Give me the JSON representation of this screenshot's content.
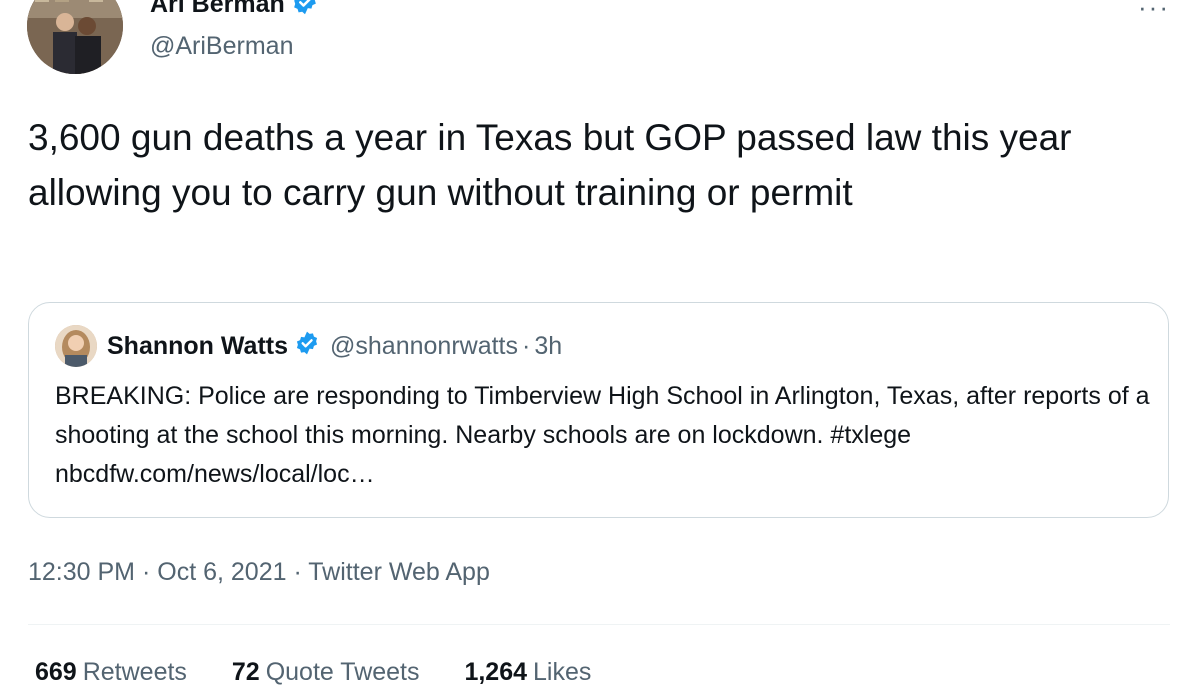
{
  "author": {
    "name": "Ari Berman",
    "handle": "@AriBerman"
  },
  "more_label": "···",
  "tweet": {
    "text": "3,600 gun deaths a year in Texas but GOP passed law this year allowing you to carry gun without training or permit"
  },
  "quote": {
    "name": "Shannon Watts",
    "handle": "@shannonrwatts",
    "separator": "·",
    "time": "3h",
    "text": "BREAKING: Police are responding to Timberview High School in Arlington, Texas, after reports of a shooting at the school this morning. Nearby schools are on lockdown. #txlege  nbcdfw.com/news/local/loc…"
  },
  "meta": {
    "time": "12:30 PM",
    "sep1": "·",
    "date": "Oct 6, 2021",
    "sep2": "·",
    "source": "Twitter Web App"
  },
  "stats": {
    "retweets_count": "669",
    "retweets_label": "Retweets",
    "quotes_count": "72",
    "quotes_label": "Quote Tweets",
    "likes_count": "1,264",
    "likes_label": "Likes"
  },
  "colors": {
    "verified": "#1d9bf0",
    "text": "#0f1419",
    "secondary": "#536471",
    "border": "#cfd9de"
  }
}
